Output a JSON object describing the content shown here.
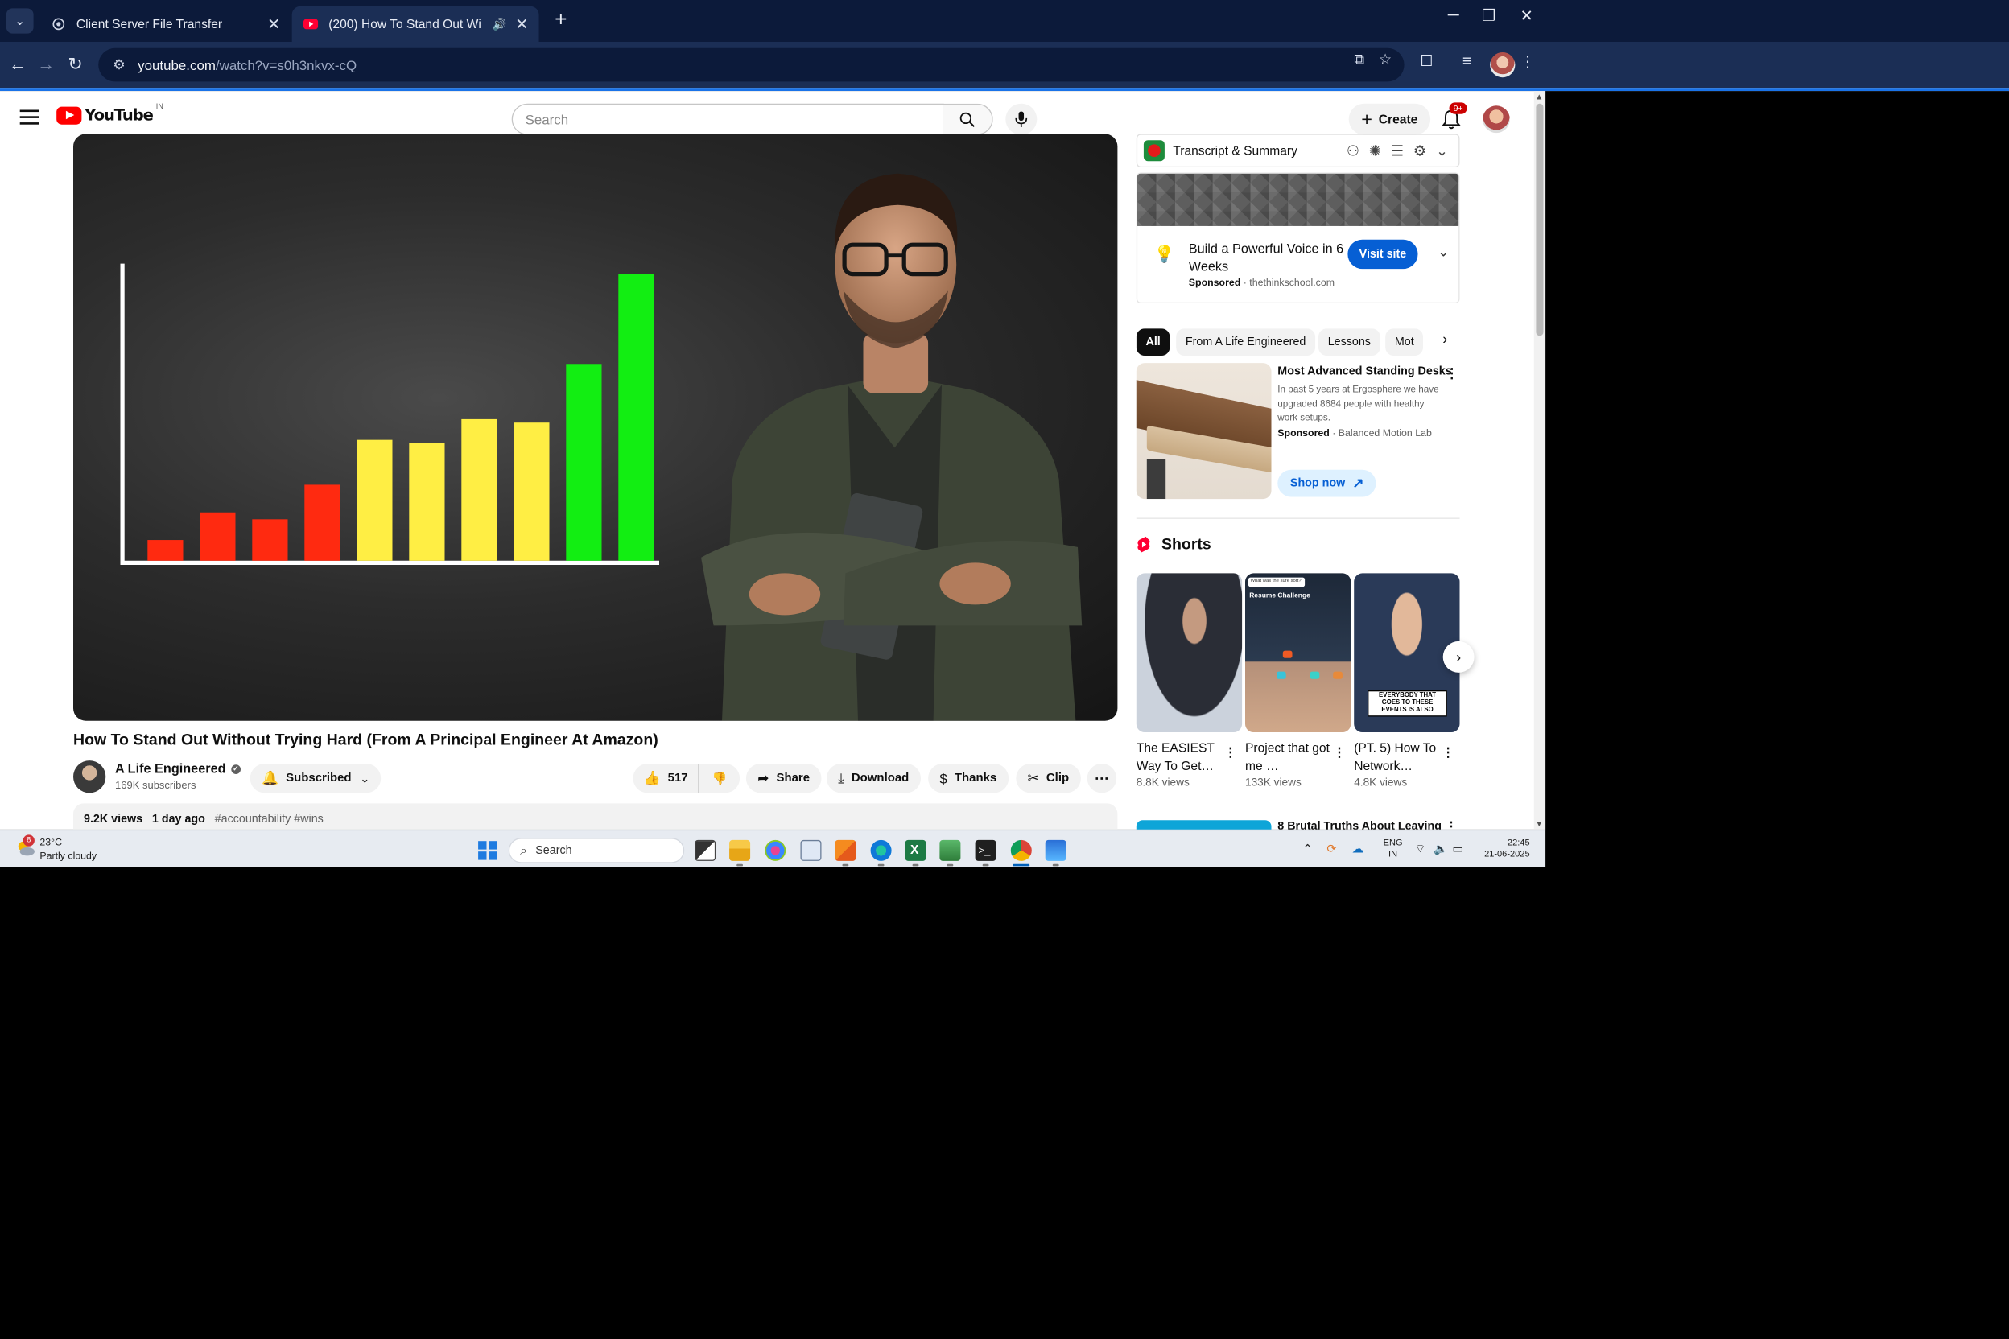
{
  "browser": {
    "tabs": [
      {
        "title": "Client Server File Transfer",
        "favicon": "globe-icon"
      },
      {
        "title": "(200) How To Stand Out Wi",
        "favicon": "youtube-icon",
        "audio": "speaker-icon",
        "active": true
      }
    ],
    "new_tab": "+",
    "url_host": "youtube.com",
    "url_path": "/watch?v=s0h3nkvx-cQ",
    "window_controls": [
      "─",
      "❐",
      "✕"
    ]
  },
  "masthead": {
    "logo_text": "YouTube",
    "country_code": "IN",
    "search_placeholder": "Search",
    "create_label": "Create",
    "notification_badge": "9+"
  },
  "video": {
    "title": "How To Stand Out Without Trying Hard (From A Principal Engineer At Amazon)",
    "channel_name": "A Life Engineered",
    "subscribers": "169K subscribers",
    "subscribed_label": "Subscribed",
    "likes": "517",
    "share_label": "Share",
    "download_label": "Download",
    "thanks_label": "Thanks",
    "clip_label": "Clip",
    "more_label": "⋯",
    "views": "9.2K views",
    "age": "1 day ago",
    "hashtags": "#accountability #wins",
    "thumbnail_chart": {
      "values": [
        0.06,
        0.14,
        0.12,
        0.22,
        0.35,
        0.34,
        0.41,
        0.4,
        0.57,
        0.83
      ],
      "colors": [
        "#ff2a10",
        "#ff2a10",
        "#ff2a10",
        "#ff2a10",
        "#ffee44",
        "#ffee44",
        "#ffee44",
        "#ffee44",
        "#12ee12",
        "#12ee12"
      ]
    }
  },
  "extension": {
    "title": "Transcript & Summary"
  },
  "ad": {
    "title": "Build a Powerful Voice in 6 Weeks",
    "sponsored": "Sponsored",
    "domain": "thethinkschool.com",
    "cta": "Visit site"
  },
  "chips": [
    "All",
    "From A Life Engineered",
    "Lessons",
    "Mot"
  ],
  "ad2": {
    "title": "Most Advanced Standing Desks",
    "text": "In past 5 years at Ergosphere we have upgraded 8684 people with healthy work setups.",
    "sponsored": "Sponsored",
    "advertiser": "Balanced Motion Lab",
    "cta": "Shop now"
  },
  "shorts": {
    "heading": "Shorts",
    "items": [
      {
        "title": "The EASIEST Way To Get…",
        "views": "8.8K views"
      },
      {
        "title": "Project that got me …",
        "views": "133K views",
        "overlay_card": "What was the sure sort?",
        "overlay_heading": "Resume Challenge"
      },
      {
        "title": "(PT. 5) How To Network…",
        "views": "4.8K views",
        "caption": "EVERYBODY THAT GOES TO THESE EVENTS IS ALSO"
      }
    ]
  },
  "next_video": {
    "title": "8 Brutal Truths About Leaving"
  },
  "taskbar": {
    "temperature": "23°C",
    "weather": "Partly cloudy",
    "weather_badge": "8",
    "search_label": "Search",
    "lang_1": "ENG",
    "lang_2": "IN",
    "time": "22:45",
    "date": "21-06-2025"
  }
}
